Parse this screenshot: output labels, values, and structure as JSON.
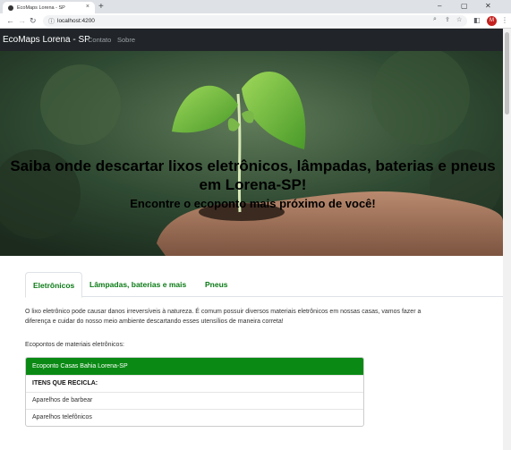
{
  "browser": {
    "tab_title": "EcoMaps Lorena - SP",
    "tab_close": "×",
    "new_tab": "+",
    "url": "localhost:4200",
    "profile_initial": "M",
    "window_controls": [
      "–",
      "▢",
      "✕"
    ]
  },
  "navbar": {
    "brand": "EcoMaps Lorena - SP",
    "links": [
      "Contato",
      "Sobre"
    ]
  },
  "hero": {
    "title": "Saiba onde descartar lixos eletrônicos, lâmpadas, baterias e pneus em Lorena-SP!",
    "subtitle": "Encontre o ecoponto mais próximo de você!"
  },
  "tabs": [
    "Eletrônicos",
    "Lâmpadas, baterias e mais",
    "Pneus"
  ],
  "content": {
    "description": "O lixo eletrônico pode causar danos irreversíveis à natureza. É comum possuir diversos materiais eletrônicos em nossas casas, vamos fazer a diferença e cuidar do nosso meio ambiente descartando esses utensílios de maneira correta!",
    "section_label": "Ecopontos de materiais eletrônicos:"
  },
  "card": {
    "header": "Ecoponto Casas Bahia Lorena-SP",
    "items_header": "ITENS QUE RECICLA:",
    "items": [
      "Aparelhos de barbear",
      "Aparelhos telefônicos"
    ]
  },
  "colors": {
    "accent_green": "#0a8a14",
    "navbar_bg": "#212529"
  }
}
